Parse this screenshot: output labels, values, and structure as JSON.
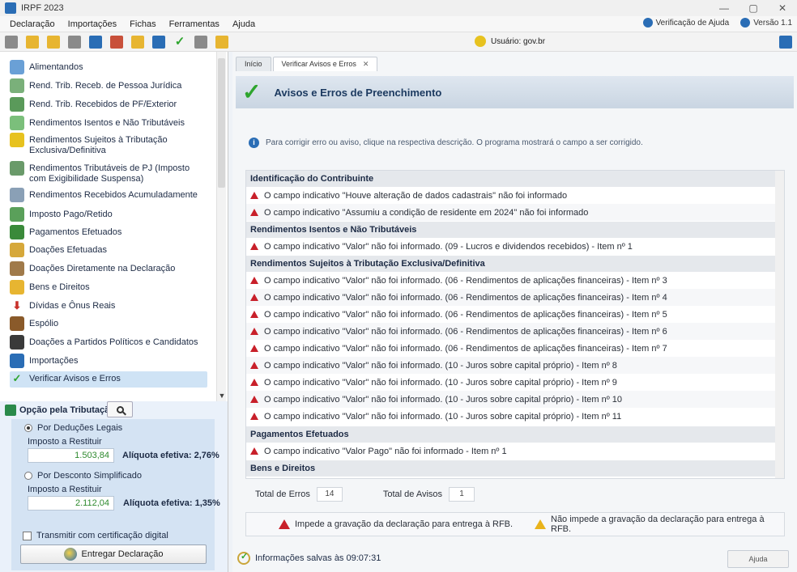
{
  "window": {
    "title": "IRPF 2023",
    "controls": [
      "—",
      "▢",
      "✕"
    ]
  },
  "menu": {
    "items": [
      "Declaração",
      "Importações",
      "Fichas",
      "Ferramentas",
      "Ajuda"
    ],
    "right": [
      "Verificação de Ajuda",
      "Versão 1.1"
    ]
  },
  "toolbar": {
    "user_label": "Usuário: gov.br"
  },
  "nav": {
    "items": [
      {
        "label": "Alimentandos",
        "icon": "people-icon",
        "color": "#6aa0d6"
      },
      {
        "label": "Rend. Trib. Receb. de Pessoa Jurídica",
        "icon": "building-icon",
        "color": "#7ab07a"
      },
      {
        "label": "Rend. Trib. Recebidos de PF/Exterior",
        "icon": "globe-icon",
        "color": "#5a9a5a"
      },
      {
        "label": "Rendimentos Isentos e Não Tributáveis",
        "icon": "coin-check-icon",
        "color": "#7bbf7b"
      },
      {
        "label": "Rendimentos Sujeitos à Tributação Exclusiva/Definitiva",
        "icon": "warning-doc-icon",
        "color": "#e7c21f"
      },
      {
        "label": "Rendimentos Tributáveis de PJ (Imposto com Exigibilidade Suspensa)",
        "icon": "people-coin-icon",
        "color": "#6a9a6a"
      },
      {
        "label": "Rendimentos Recebidos Acumuladamente",
        "icon": "stack-coins-icon",
        "color": "#8aa0b6"
      },
      {
        "label": "Imposto Pago/Retido",
        "icon": "coin-icon",
        "color": "#5aa05a"
      },
      {
        "label": "Pagamentos Efetuados",
        "icon": "money-icon",
        "color": "#3a8a3a"
      },
      {
        "label": "Doações Efetuadas",
        "icon": "gift-doc-icon",
        "color": "#d6a83a"
      },
      {
        "label": "Doações Diretamente na Declaração",
        "icon": "donation-icon",
        "color": "#a07a4a"
      },
      {
        "label": "Bens e Direitos",
        "icon": "dollar-doc-icon",
        "color": "#e7b531"
      },
      {
        "label": "Dívidas e Ônus Reais",
        "icon": "arrow-down-red-icon",
        "color": "#c8302a"
      },
      {
        "label": "Espólio",
        "icon": "chest-icon",
        "color": "#8a5a2a"
      },
      {
        "label": "Doações a Partidos Políticos e Candidatos",
        "icon": "candidate-icon",
        "color": "#3a3a3a"
      },
      {
        "label": "Importações",
        "icon": "import-globe-icon",
        "color": "#2a6db5"
      },
      {
        "label": "Verificar Avisos e Erros",
        "icon": "check-icon",
        "color": "#2ea52e"
      }
    ]
  },
  "tax": {
    "header": "Opção pela Tributação:",
    "legal_option": "Por Deduções Legais",
    "legal_refund_label": "Imposto a Restituir",
    "legal_refund_value": "1.503,84",
    "legal_rate": "Alíquota efetiva: 2,76%",
    "simple_option": "Por Desconto Simplificado",
    "simple_refund_label": "Imposto a Restituir",
    "simple_refund_value": "2.112,04",
    "simple_rate": "Alíquota efetiva: 1,35%",
    "cert_label": "Transmitir com certificação digital",
    "deliver_button": "Entregar Declaração"
  },
  "tabs": [
    {
      "label": "Início"
    },
    {
      "label": "Verificar Avisos e Erros"
    }
  ],
  "main": {
    "title": "Avisos e Erros de Preenchimento",
    "info": "Para corrigir erro ou aviso, clique na respectiva descrição. O programa mostrará o campo a ser corrigido."
  },
  "issues": {
    "sections": [
      {
        "title": "Identificação do Contribuinte"
      },
      {
        "title": "Rendimentos Isentos e Não Tributáveis"
      },
      {
        "title": "Rendimentos Sujeitos à Tributação Exclusiva/Definitiva"
      },
      {
        "title": "Pagamentos Efetuados"
      },
      {
        "title": "Bens e Direitos"
      }
    ],
    "rows": [
      "O campo indicativo \"Houve alteração de dados cadastrais\" não foi informado",
      "O campo indicativo \"Assumiu a condição de residente em 2024\" não foi informado",
      "O campo indicativo \"Valor\" não foi informado. (09 - Lucros e dividendos recebidos) - Item nº 1",
      "O campo indicativo \"Valor\" não foi informado. (06 - Rendimentos de aplicações financeiras) - Item nº 3",
      "O campo indicativo \"Valor\" não foi informado. (06 - Rendimentos de aplicações financeiras) - Item nº 4",
      "O campo indicativo \"Valor\" não foi informado. (06 - Rendimentos de aplicações financeiras) - Item nº 5",
      "O campo indicativo \"Valor\" não foi informado. (06 - Rendimentos de aplicações financeiras) - Item nº 6",
      "O campo indicativo \"Valor\" não foi informado. (06 - Rendimentos de aplicações financeiras) - Item nº 7",
      "O campo indicativo \"Valor\" não foi informado. (10 - Juros sobre capital próprio) - Item nº 8",
      "O campo indicativo \"Valor\" não foi informado. (10 - Juros sobre capital próprio) - Item nº 9",
      "O campo indicativo \"Valor\" não foi informado. (10 - Juros sobre capital próprio) - Item nº 10",
      "O campo indicativo \"Valor\" não foi informado. (10 - Juros sobre capital próprio) - Item nº 11",
      "O campo indicativo \"Valor Pago\" não foi informado - Item nº 1"
    ]
  },
  "totals": {
    "errors_label": "Total de Erros",
    "errors_value": "14",
    "warnings_label": "Total de Avisos",
    "warnings_value": "1"
  },
  "legend": {
    "red": "Impede a gravação da declaração para entrega à RFB.",
    "yellow": "Não impede a gravação da declaração para entrega à RFB."
  },
  "status": {
    "saved": "Informações salvas às 09:07:31"
  },
  "help_button": "Ajuda"
}
